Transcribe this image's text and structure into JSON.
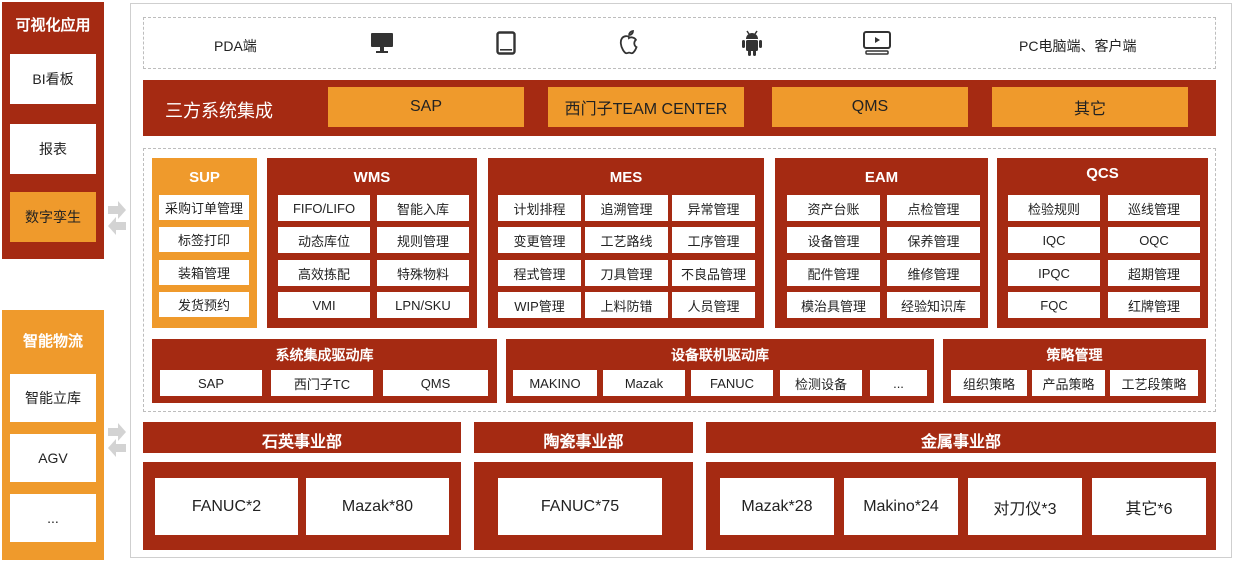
{
  "left_panels": {
    "visual": {
      "title": "可视化应用",
      "items": [
        "BI看板",
        "报表",
        "数字孪生"
      ]
    },
    "logistics": {
      "title": "智能物流",
      "items": [
        "智能立库",
        "AGV",
        "..."
      ]
    }
  },
  "terminals": {
    "pda": "PDA端",
    "pc": "PC电脑端、客户端"
  },
  "third_party": {
    "title": "三方系统集成",
    "items": [
      "SAP",
      "西门子TEAM CENTER",
      "QMS",
      "其它"
    ]
  },
  "modules": {
    "sup": {
      "title": "SUP",
      "items": [
        "采购订单管理",
        "标签打印",
        "装箱管理",
        "发货预约"
      ]
    },
    "wms": {
      "title": "WMS",
      "items": [
        "FIFO/LIFO",
        "智能入库",
        "动态库位",
        "规则管理",
        "高效拣配",
        "特殊物料",
        "VMI",
        "LPN/SKU"
      ]
    },
    "mes": {
      "title": "MES",
      "items": [
        "计划排程",
        "追溯管理",
        "异常管理",
        "变更管理",
        "工艺路线",
        "工序管理",
        "程式管理",
        "刀具管理",
        "不良品管理",
        "WIP管理",
        "上料防错",
        "人员管理"
      ]
    },
    "eam": {
      "title": "EAM",
      "items": [
        "资产台账",
        "点检管理",
        "设备管理",
        "保养管理",
        "配件管理",
        "维修管理",
        "模治具管理",
        "经验知识库"
      ]
    },
    "qcs": {
      "title": "QCS",
      "items": [
        "检验规则",
        "巡线管理",
        "IQC",
        "OQC",
        "IPQC",
        "超期管理",
        "FQC",
        "红牌管理"
      ]
    }
  },
  "drivers": {
    "system": {
      "title": "系统集成驱动库",
      "items": [
        "SAP",
        "西门子TC",
        "QMS"
      ]
    },
    "device": {
      "title": "设备联机驱动库",
      "items": [
        "MAKINO",
        "Mazak",
        "FANUC",
        "检测设备",
        "..."
      ]
    },
    "strategy": {
      "title": "策略管理",
      "items": [
        "组织策略",
        "产品策略",
        "工艺段策略"
      ]
    }
  },
  "divisions": [
    {
      "title": "石英事业部",
      "items": [
        "FANUC*2",
        "Mazak*80"
      ]
    },
    {
      "title": "陶瓷事业部",
      "items": [
        "FANUC*75"
      ]
    },
    {
      "title": "金属事业部",
      "items": [
        "Mazak*28",
        "Makino*24",
        "对刀仪*3",
        "其它*6"
      ]
    }
  ],
  "colors": {
    "dark_red": "#a52a12",
    "orange": "#ef9a2c"
  },
  "icons": [
    "monitor-icon",
    "tablet-icon",
    "apple-icon",
    "android-icon",
    "tv-icon",
    "double-arrow-icon"
  ]
}
